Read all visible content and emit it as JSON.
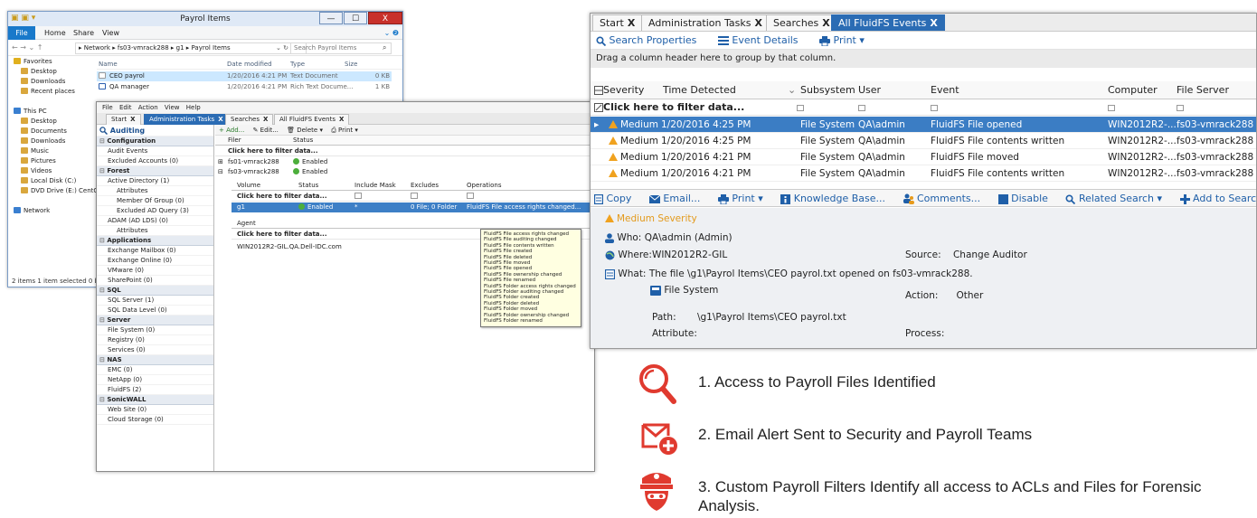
{
  "explorer": {
    "title": "Payrol Items",
    "quick_access": "▣ ▣ ▾",
    "min_glyph": "—",
    "max_glyph": "☐",
    "close_glyph": "X",
    "ribbon": {
      "file": "File",
      "home": "Home",
      "share": "Share",
      "view": "View",
      "expand": "⌄ ❷"
    },
    "nav_buttons": "← →  ⌄ ↑",
    "path": "▸ Network ▸ fs03-vmrack288 ▸ g1 ▸ Payrol Items",
    "path_controls": "⌄  ↻",
    "search_placeholder": "Search Payrol Items",
    "search_glyph": "⌕",
    "nav_pane": [
      "Favorites",
      "Desktop",
      "Downloads",
      "Recent places",
      "",
      "This PC",
      "Desktop",
      "Documents",
      "Downloads",
      "Music",
      "Pictures",
      "Videos",
      "Local Disk (C:)",
      "DVD Drive (E:) CentO",
      "",
      "Network"
    ],
    "columns": {
      "name": "Name",
      "date": "Date modified",
      "type": "Type",
      "size": "Size"
    },
    "files": [
      {
        "name": "CEO payrol",
        "date": "1/20/2016 4:21 PM",
        "type": "Text Document",
        "size": "0 KB"
      },
      {
        "name": "QA manager",
        "date": "1/20/2016 4:21 PM",
        "type": "Rich Text Docume...",
        "size": "1 KB"
      }
    ],
    "status": "2 items    1 item selected 0 bytes"
  },
  "auditor": {
    "menu": [
      "File",
      "Edit",
      "Action",
      "View",
      "Help"
    ],
    "tabs": [
      "Start",
      "Administration Tasks",
      "Searches",
      "All FluidFS Events"
    ],
    "tab_close": "X",
    "left_title": "Auditing",
    "left_items": [
      {
        "t": "Configuration",
        "k": "head"
      },
      {
        "t": "Audit Events",
        "k": "item"
      },
      {
        "t": "Excluded Accounts (0)",
        "k": "item"
      },
      {
        "t": "Forest",
        "k": "head"
      },
      {
        "t": "Active Directory (1)",
        "k": "item"
      },
      {
        "t": "Attributes",
        "k": "sub"
      },
      {
        "t": "Member Of Group (0)",
        "k": "sub"
      },
      {
        "t": "Excluded AD Query (3)",
        "k": "sub"
      },
      {
        "t": "ADAM (AD LDS) (0)",
        "k": "item"
      },
      {
        "t": "Attributes",
        "k": "sub"
      },
      {
        "t": "Applications",
        "k": "head"
      },
      {
        "t": "Exchange Mailbox (0)",
        "k": "item"
      },
      {
        "t": "Exchange Online (0)",
        "k": "item"
      },
      {
        "t": "VMware (0)",
        "k": "item"
      },
      {
        "t": "SharePoint (0)",
        "k": "item"
      },
      {
        "t": "SQL",
        "k": "head"
      },
      {
        "t": "SQL Server (1)",
        "k": "item"
      },
      {
        "t": "SQL Data Level (0)",
        "k": "item"
      },
      {
        "t": "Server",
        "k": "head"
      },
      {
        "t": "File System (0)",
        "k": "item"
      },
      {
        "t": "Registry (0)",
        "k": "item"
      },
      {
        "t": "Services (0)",
        "k": "item"
      },
      {
        "t": "NAS",
        "k": "head"
      },
      {
        "t": "EMC (0)",
        "k": "item"
      },
      {
        "t": "NetApp (0)",
        "k": "item"
      },
      {
        "t": "FluidFS (2)",
        "k": "item"
      },
      {
        "t": "SonicWALL",
        "k": "head"
      },
      {
        "t": "Web Site (0)",
        "k": "item"
      },
      {
        "t": "Cloud Storage (0)",
        "k": "item"
      }
    ],
    "toolbar": {
      "add": "+ Add...",
      "edit": "✎ Edit...",
      "delete": "🗑 Delete ▾",
      "print": "⎙ Print ▾"
    },
    "filer_head": {
      "filer": "Filer",
      "status": "Status"
    },
    "filter_text": "Click here to filter data...",
    "filers": [
      {
        "name": "fs01-vmrack288",
        "status": "Enabled"
      },
      {
        "name": "fs03-vmrack288",
        "status": "Enabled"
      }
    ],
    "expand_plus": "⊞",
    "expand_minus": "⊟",
    "filter_icon": "⧉",
    "volume_head": {
      "volume": "Volume",
      "status": "Status",
      "include": "Include Mask",
      "excludes": "Excludes",
      "operations": "Operations"
    },
    "volume_row": {
      "volume": "g1",
      "status": "Enabled",
      "include": "*",
      "excludes": "0 File; 0 Folder",
      "operations": "FluidFS File access rights changed..."
    },
    "agent_head": "Agent",
    "agent_row": "WIN2012R2-GIL.QA.Dell-IDC.com",
    "popup": [
      "FluidFS File access rights changed",
      "FluidFS File auditing changed",
      "FluidFS File contents written",
      "FluidFS File created",
      "FluidFS File deleted",
      "FluidFS File moved",
      "FluidFS File opened",
      "FluidFS File ownership changed",
      "FluidFS File renamed",
      "FluidFS Folder access rights changed",
      "FluidFS Folder auditing changed",
      "FluidFS Folder created",
      "FluidFS Folder deleted",
      "FluidFS Folder moved",
      "FluidFS Folder ownership changed",
      "FluidFS Folder renamed"
    ]
  },
  "events": {
    "tabs": [
      "Start",
      "Administration Tasks",
      "Searches",
      "All FluidFS Events"
    ],
    "tab_close": "X",
    "toolbar": {
      "search_properties": "Search Properties",
      "event_details": "Event Details",
      "print": "Print ▾"
    },
    "group_hint": "Drag a column header here to group by that column.",
    "columns": {
      "severity": "Severity",
      "time": "Time Detected",
      "subsystem": "Subsystem",
      "user": "User",
      "event": "Event",
      "computer": "Computer",
      "file_server": "File Server"
    },
    "filter_text": "Click here to filter data...",
    "filter_icon": "⧉",
    "rows": [
      {
        "severity": "Medium",
        "time": "1/20/2016 4:25 PM",
        "subsystem": "File System",
        "user": "QA\\admin",
        "event": "FluidFS File opened",
        "computer": "WIN2012R2-...",
        "file_server": "fs03-vmrack288"
      },
      {
        "severity": "Medium",
        "time": "1/20/2016 4:25 PM",
        "subsystem": "File System",
        "user": "QA\\admin",
        "event": "FluidFS File contents written",
        "computer": "WIN2012R2-...",
        "file_server": "fs03-vmrack288"
      },
      {
        "severity": "Medium",
        "time": "1/20/2016 4:21 PM",
        "subsystem": "File System",
        "user": "QA\\admin",
        "event": "FluidFS File moved",
        "computer": "WIN2012R2-...",
        "file_server": "fs03-vmrack288"
      },
      {
        "severity": "Medium",
        "time": "1/20/2016 4:21 PM",
        "subsystem": "File System",
        "user": "QA\\admin",
        "event": "FluidFS File contents written",
        "computer": "WIN2012R2-...",
        "file_server": "fs03-vmrack288"
      }
    ],
    "actions": {
      "copy": "Copy",
      "email": "Email...",
      "print": "Print ▾",
      "kb": "Knowledge Base...",
      "comments": "Comments...",
      "disable": "Disable",
      "related": "Related Search ▾",
      "add": "Add to Search ▾"
    },
    "detail": {
      "severity": "Medium Severity",
      "who_label": "Who:",
      "who": "QA\\admin (Admin)",
      "where_label": "Where:",
      "where": "WIN2012R2-GIL",
      "source_label": "Source:",
      "source": "Change Auditor",
      "what_label": "What:",
      "what": "The file \\g1\\Payrol Items\\CEO payrol.txt opened on fs03-vmrack288.",
      "subsystem": "File System",
      "action_label": "Action:",
      "action": "Other",
      "path_label": "Path:",
      "path": "\\g1\\Payrol Items\\CEO payrol.txt",
      "attribute_label": "Attribute:",
      "process_label": "Process:"
    }
  },
  "steps": [
    {
      "icon": "magnifier-icon",
      "text": "1. Access to Payroll Files Identified"
    },
    {
      "icon": "email-alert-icon",
      "text": "2. Email Alert Sent to Security and Payroll Teams"
    },
    {
      "icon": "security-officer-icon",
      "text": "3. Custom Payroll Filters Identify all access to ACLs and Files for Forensic Analysis."
    }
  ],
  "colors": {
    "accent_red": "#e03a2f",
    "selection_blue": "#3b7dc4",
    "link_blue": "#1f5fa8",
    "warning_orange": "#f0a21f"
  }
}
